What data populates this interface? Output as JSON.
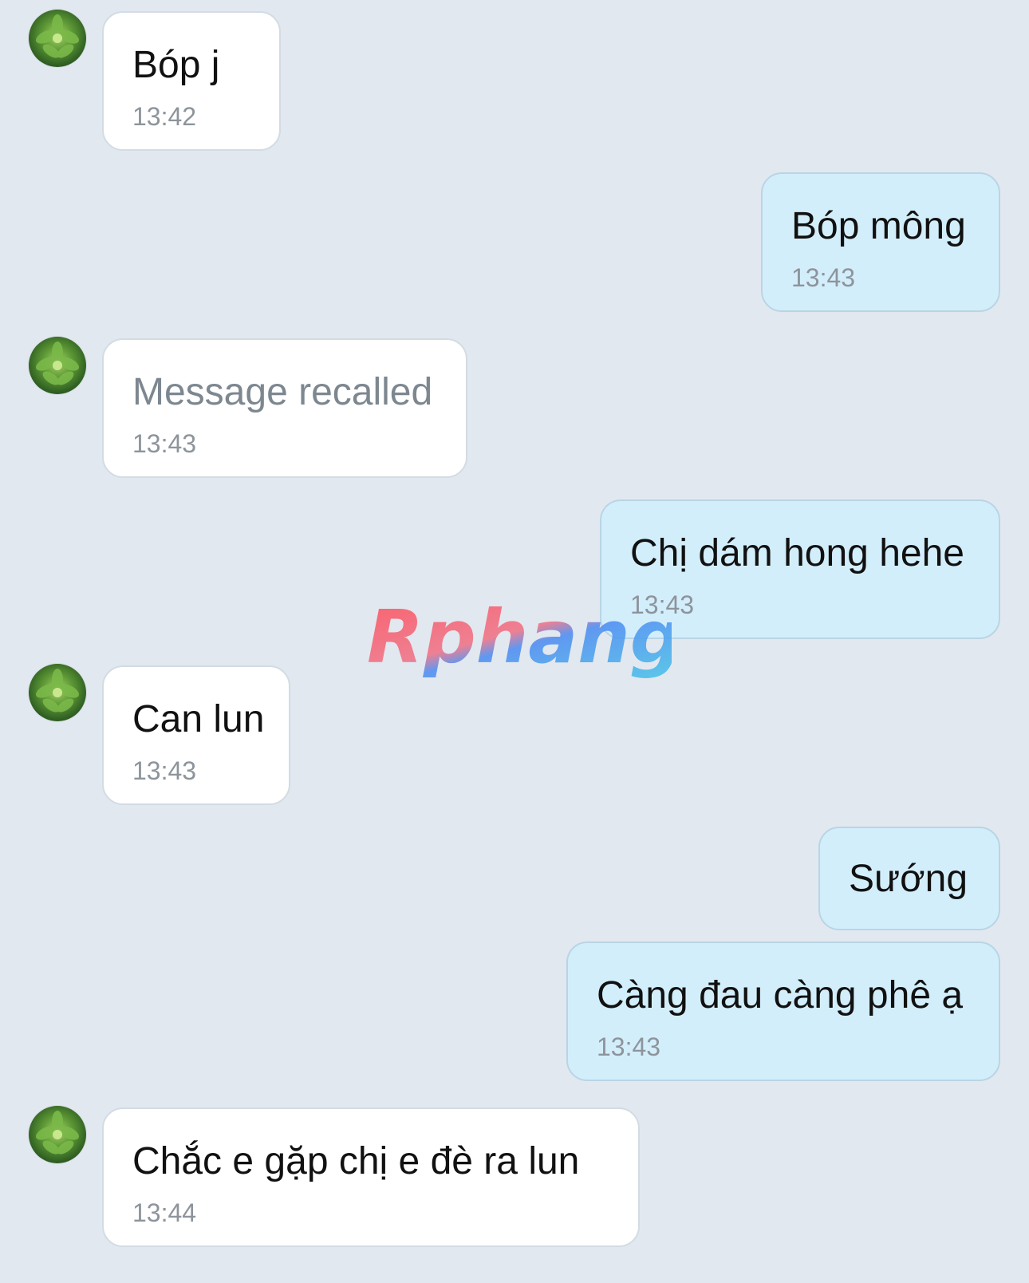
{
  "messages": [
    {
      "direction": "in",
      "text": "Bóp j",
      "time": "13:42"
    },
    {
      "direction": "out",
      "text": "Bóp mông",
      "time": "13:43"
    },
    {
      "direction": "in",
      "text": "Message recalled",
      "time": "13:43",
      "recalled": true
    },
    {
      "direction": "out",
      "text": "Chị dám hong hehe",
      "time": "13:43"
    },
    {
      "direction": "in",
      "text": "Can lun",
      "time": "13:43"
    },
    {
      "direction": "out",
      "text": "Sướng",
      "time": ""
    },
    {
      "direction": "out",
      "text": "Càng đau càng phê ạ",
      "time": "13:43"
    },
    {
      "direction": "in",
      "text": "Chắc e gặp chị e đè ra lun",
      "time": "13:44"
    }
  ],
  "watermark": {
    "text": "Rphang"
  },
  "colors": {
    "background": "#e2e8ef",
    "incoming_bubble": "#ffffff",
    "outgoing_bubble": "#d3eefb",
    "timestamp": "#8d949b"
  },
  "icons": {
    "avatar": "leaf-avatar-icon"
  }
}
